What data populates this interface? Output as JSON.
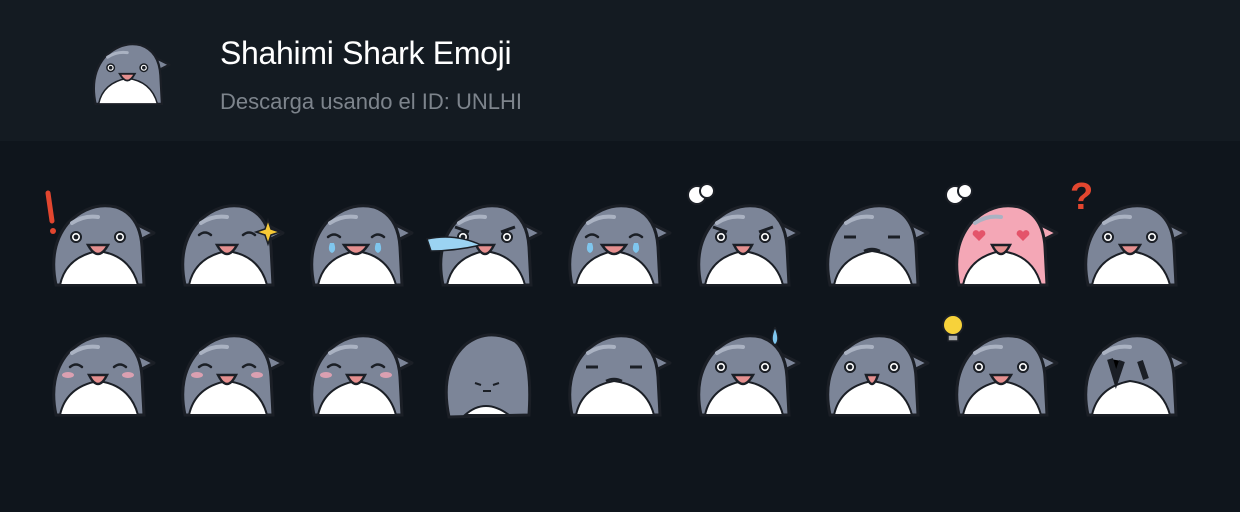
{
  "pack": {
    "title": "Shahimi Shark Emoji",
    "subtitle": "Descarga usando el ID: UNLHI",
    "icon": "shark-happy"
  },
  "colors": {
    "background": "#0f151c",
    "header": "#141b22",
    "body": "#7c8598",
    "belly": "#ffffff",
    "outline": "#1b1f26",
    "mouth": "#e58f8f",
    "pink": "#f4a7b6"
  },
  "stickers": [
    {
      "name": "shark-surprised-exclaim",
      "expression": "surprised",
      "extra": "exclaim"
    },
    {
      "name": "shark-wink-sparkle",
      "expression": "wink",
      "extra": "sparkle"
    },
    {
      "name": "shark-laugh-tears",
      "expression": "laugh-tears",
      "extra": ""
    },
    {
      "name": "shark-angry-blue-breath",
      "expression": "angry",
      "extra": "breath"
    },
    {
      "name": "shark-crying",
      "expression": "crying",
      "extra": ""
    },
    {
      "name": "shark-annoyed-steam",
      "expression": "annoyed",
      "extra": "steam"
    },
    {
      "name": "shark-thinking",
      "expression": "thinking",
      "extra": ""
    },
    {
      "name": "shark-pink-heart-eyes",
      "expression": "love",
      "extra": "steam"
    },
    {
      "name": "shark-confused-question",
      "expression": "confused",
      "extra": "question"
    },
    {
      "name": "shark-grin-blush",
      "expression": "smug",
      "extra": ""
    },
    {
      "name": "shark-wave-hello",
      "expression": "happy",
      "extra": ""
    },
    {
      "name": "shark-happy-blush",
      "expression": "blush",
      "extra": ""
    },
    {
      "name": "shark-turned-away",
      "expression": "back",
      "extra": ""
    },
    {
      "name": "shark-facepalm",
      "expression": "facepalm",
      "extra": ""
    },
    {
      "name": "shark-nervous-sweat",
      "expression": "nervous",
      "extra": "sweat"
    },
    {
      "name": "shark-shocked-stare",
      "expression": "shocked",
      "extra": ""
    },
    {
      "name": "shark-idea-bulb",
      "expression": "idea",
      "extra": "bulb"
    },
    {
      "name": "shark-burnt-ash",
      "expression": "burnt",
      "extra": ""
    }
  ]
}
